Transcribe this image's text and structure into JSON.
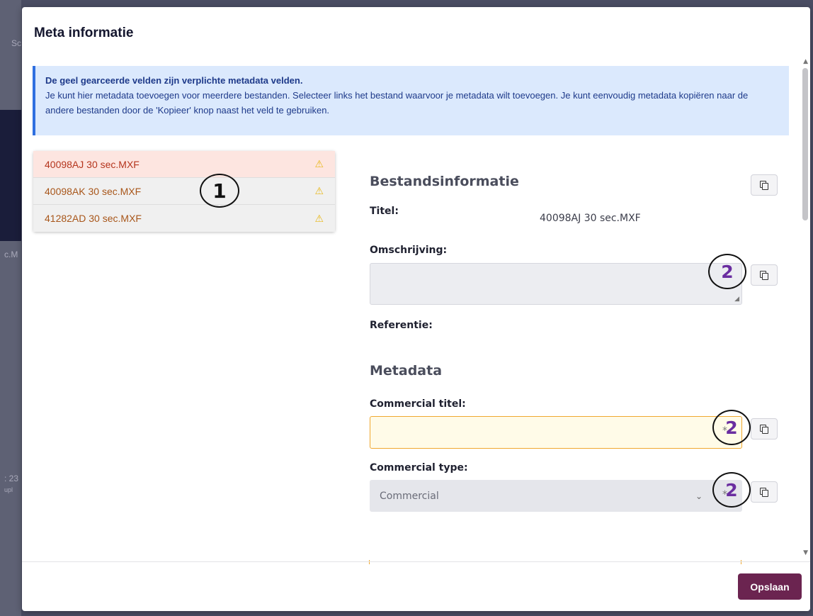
{
  "background": {
    "fragment_top": "Sc",
    "fragment_mid": "c.M",
    "fragment_low": ": 23",
    "fragment_low2": "upl"
  },
  "modal": {
    "title": "Meta informatie",
    "info": {
      "heading": "De geel gearceerde velden zijn verplichte metadata velden.",
      "body": "Je kunt hier metadata toevoegen voor meerdere bestanden. Selecteer links het bestand waarvoor je metadata wilt toevoegen. Je kunt eenvoudig metadata kopiëren naar de andere bestanden door de 'Kopieer' knop naast het veld te gebruiken."
    },
    "files": [
      {
        "name": "40098AJ 30 sec.MXF",
        "active": true
      },
      {
        "name": "40098AK 30 sec.MXF",
        "active": false
      },
      {
        "name": "41282AD 30 sec.MXF",
        "active": false
      }
    ],
    "warning_icon": "⚠",
    "sections": {
      "file_info_title": "Bestandsinformatie",
      "metadata_title": "Metadata"
    },
    "fields": {
      "title_label": "Titel:",
      "title_value": "40098AJ 30 sec.MXF",
      "description_label": "Omschrijving:",
      "description_value": "",
      "reference_label": "Referentie:",
      "commercial_title_label": "Commercial titel:",
      "commercial_title_value": "",
      "commercial_type_label": "Commercial type:",
      "commercial_type_value": "Commercial",
      "required_marker": "*"
    },
    "annotations": {
      "one": "1",
      "two": "2"
    },
    "save_label": "Opslaan"
  },
  "colors": {
    "accent": "#6b2450",
    "info_border": "#2f6fe0",
    "required_border": "#f0a830",
    "active_file_bg": "#fde5e0",
    "annotation_two": "#6a2da0"
  }
}
